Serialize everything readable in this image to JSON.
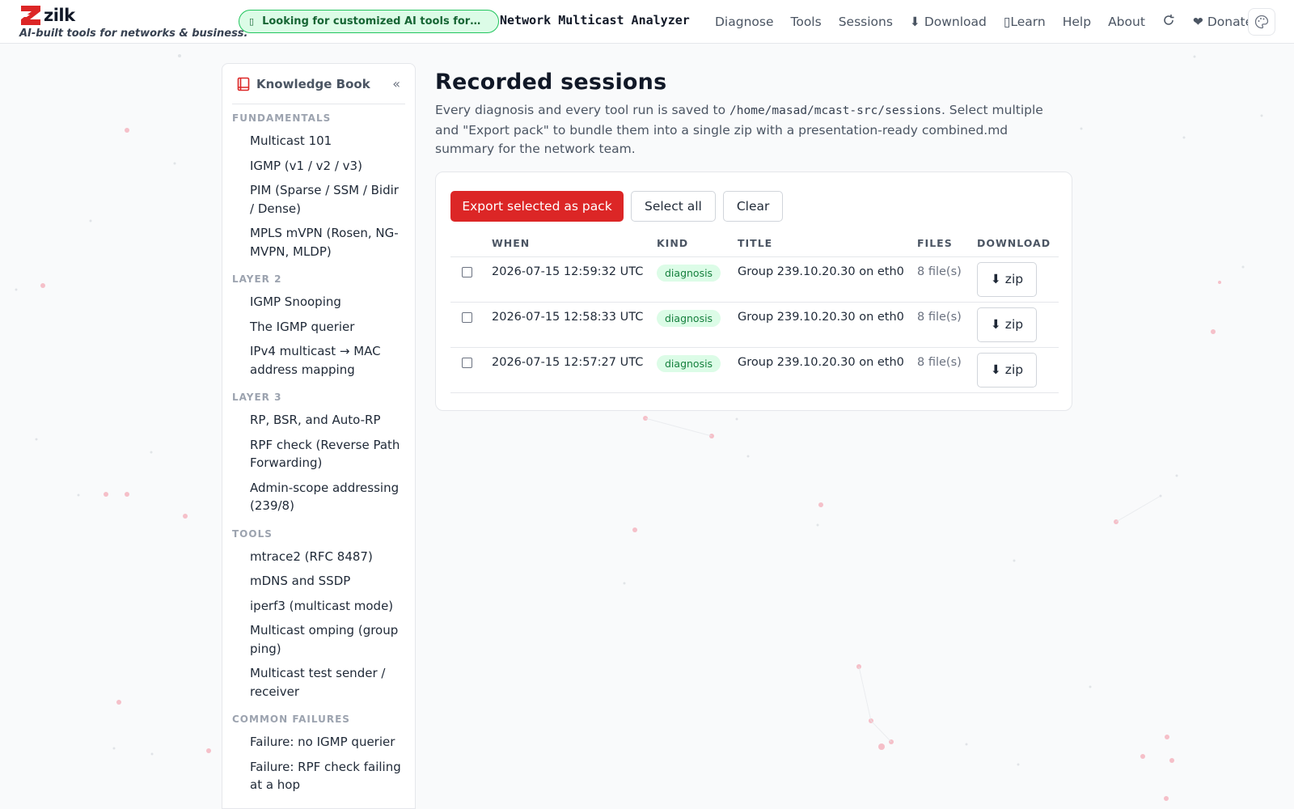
{
  "brand": {
    "name": "zilk",
    "tagline": "AI-built tools for networks & business."
  },
  "promo": {
    "icon": "sparkle-icon",
    "text": "Looking for customized AI tools for y..."
  },
  "app_title": "Network Multicast Analyzer",
  "nav": {
    "diagnose": "Diagnose",
    "tools": "Tools",
    "sessions": "Sessions",
    "download": "⬇ Download",
    "learn": "Learn",
    "help": "Help",
    "about": "About",
    "donate": "❤ Donate"
  },
  "sidebar": {
    "title": "Knowledge Book",
    "collapse": "«",
    "sections": [
      {
        "title": "FUNDAMENTALS",
        "items": [
          "Multicast 101",
          "IGMP (v1 / v2 / v3)",
          "PIM (Sparse / SSM / Bidir / Dense)",
          "MPLS mVPN (Rosen, NG-MVPN, MLDP)"
        ]
      },
      {
        "title": "LAYER 2",
        "items": [
          "IGMP Snooping",
          "The IGMP querier",
          "IPv4 multicast → MAC address mapping"
        ]
      },
      {
        "title": "LAYER 3",
        "items": [
          "RP, BSR, and Auto-RP",
          "RPF check (Reverse Path Forwarding)",
          "Admin-scope addressing (239/8)"
        ]
      },
      {
        "title": "TOOLS",
        "items": [
          "mtrace2 (RFC 8487)",
          "mDNS and SSDP",
          "iperf3 (multicast mode)",
          "Multicast omping (group ping)",
          "Multicast test sender / receiver"
        ]
      },
      {
        "title": "COMMON FAILURES",
        "items": [
          "Failure: no IGMP querier",
          "Failure: RPF check failing at a hop"
        ]
      }
    ]
  },
  "main": {
    "title": "Recorded sessions",
    "desc_before": "Every diagnosis and every tool run is saved to ",
    "desc_path": "/home/masad/mcast-src/sessions",
    "desc_after": ". Select multiple and \"Export pack\" to bundle them into a single zip with a presentation-ready combined.md summary for the network team.",
    "export_label": "Export selected as pack",
    "select_all_label": "Select all",
    "clear_label": "Clear",
    "columns": [
      "WHEN",
      "KIND",
      "TITLE",
      "FILES",
      "DOWNLOAD"
    ],
    "rows": [
      {
        "when": "2026-07-15 12:59:32 UTC",
        "kind": "diagnosis",
        "title": "Group 239.10.20.30 on eth0",
        "files": "8 file(s)",
        "download": "⬇ zip"
      },
      {
        "when": "2026-07-15 12:58:33 UTC",
        "kind": "diagnosis",
        "title": "Group 239.10.20.30 on eth0",
        "files": "8 file(s)",
        "download": "⬇ zip"
      },
      {
        "when": "2026-07-15 12:57:27 UTC",
        "kind": "diagnosis",
        "title": "Group 239.10.20.30 on eth0",
        "files": "8 file(s)",
        "download": "⬇ zip"
      }
    ]
  },
  "colors": {
    "accent": "#dc2626",
    "badge_bg": "#dcfce7",
    "badge_text": "#15803d",
    "promo_border": "#22c55e"
  }
}
